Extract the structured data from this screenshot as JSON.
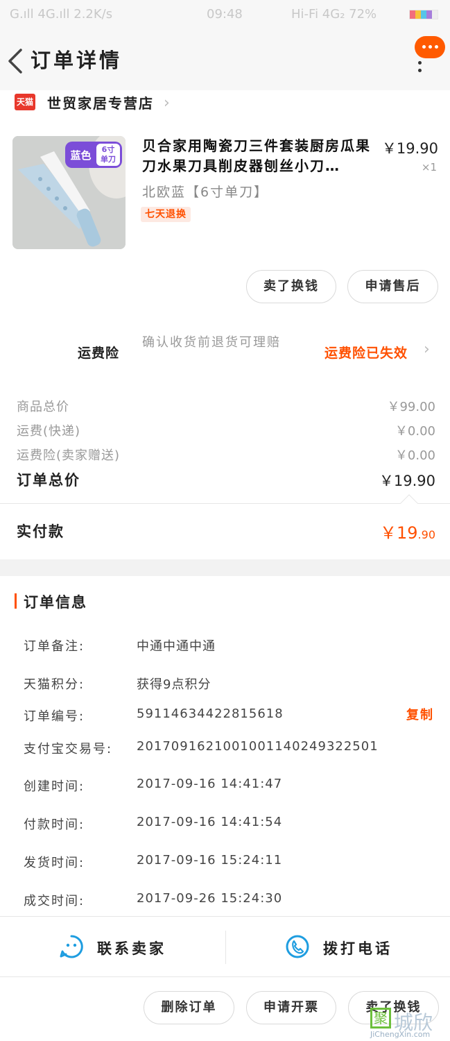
{
  "status_bar": {
    "left": "G.ıll  4G.ıll  2.2K/s",
    "time": "09:48",
    "right": "Hi-Fi  4G₂ 72%"
  },
  "header": {
    "title": "订单详情",
    "back_icon": "chevron-left-icon",
    "more_icon": "more-vertical-icon",
    "accent": "#ff5a00"
  },
  "store": {
    "badge": "天猫",
    "name": "世贸家居专营店"
  },
  "product": {
    "title": "贝合家用陶瓷刀三件套装厨房瓜果刀水果刀具削皮器刨丝小刀…",
    "sku": "北欧蓝【6寸单刀】",
    "badge": "七天退换",
    "price": "￥19.90",
    "qty": "×1",
    "image_tag_color": "蓝色",
    "image_tag_size": "6寸\n单刀"
  },
  "actions_top": {
    "sell_label": "卖了换钱",
    "after_sale_label": "申请售后"
  },
  "insurance": {
    "label": "运费险",
    "desc": "确认收货前退货可理赔",
    "status": "运费险已失效"
  },
  "summary": {
    "items": [
      {
        "label": "商品总价",
        "value": "￥99.00"
      },
      {
        "label": "运费(快递)",
        "value": "￥0.00"
      },
      {
        "label": "运费险(卖家赠送)",
        "value": "￥0.00"
      }
    ],
    "total_label": "订单总价",
    "total_value": "￥19.90",
    "paid_label": "实付款",
    "paid_currency": "￥",
    "paid_int": "19",
    "paid_dec": ".90"
  },
  "order_info": {
    "title": "订单信息",
    "rows": [
      {
        "label": "订单备注:",
        "value": "中通中通中通"
      },
      {
        "label": "天猫积分:",
        "value": "获得9点积分"
      },
      {
        "label": "订单编号:",
        "value": "59114634422815618"
      },
      {
        "label": "支付宝交易号:",
        "value": "2017091621001001140249322501"
      },
      {
        "label": "创建时间:",
        "value": "2017-09-16 14:41:47"
      },
      {
        "label": "付款时间:",
        "value": "2017-09-16 14:41:54"
      },
      {
        "label": "发货时间:",
        "value": "2017-09-16 15:24:11"
      },
      {
        "label": "成交时间:",
        "value": "2017-09-26 15:24:30"
      }
    ],
    "copy_label": "复制"
  },
  "contact": {
    "seller_label": "联系卖家",
    "phone_label": "拨打电话",
    "icon_color": "#1e9de0"
  },
  "bottom_actions": {
    "delete_label": "删除订单",
    "invoice_label": "申请开票",
    "sell_label": "卖了换钱"
  },
  "watermark": {
    "mark": "聚",
    "text": "城欣",
    "sub": "JiChengXin.com"
  }
}
